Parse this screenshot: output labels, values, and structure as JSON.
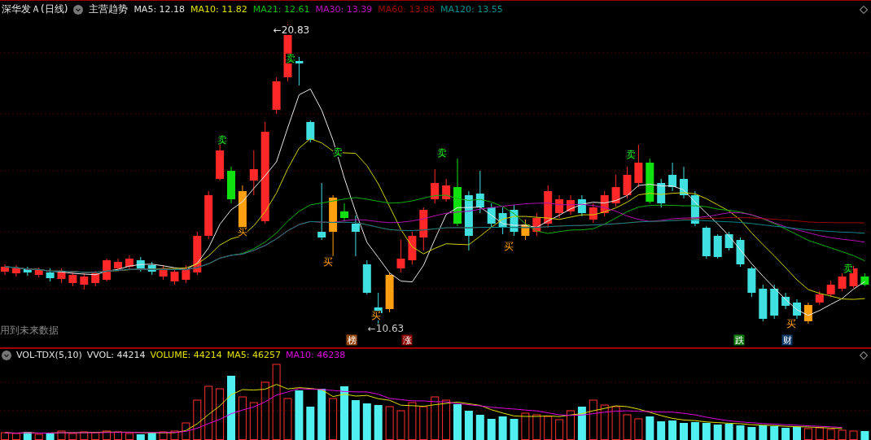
{
  "header": {
    "title": "深华发Ａ(日线)",
    "indicator_name": "主营趋势",
    "values": [
      {
        "text": "MA5: 12.18",
        "color": "#e0e0e0"
      },
      {
        "text": "MA10: 11.82",
        "color": "#e0e000"
      },
      {
        "text": "MA21: 12.61",
        "color": "#10c010"
      },
      {
        "text": "MA30: 13.39",
        "color": "#c010c0"
      },
      {
        "text": "MA60: 13.88",
        "color": "#a00000"
      },
      {
        "text": "MA120: 13.55",
        "color": "#009090"
      }
    ]
  },
  "main_chart": {
    "signals": [
      {
        "text": "卖",
        "kind": "sell"
      },
      {
        "text": "买",
        "kind": "buy"
      },
      {
        "text": "卖",
        "kind": "sell"
      },
      {
        "text": "买",
        "kind": "buy"
      },
      {
        "text": "卖",
        "kind": "sell"
      },
      {
        "text": "买",
        "kind": "buy"
      },
      {
        "text": "卖",
        "kind": "sell"
      },
      {
        "text": "买",
        "kind": "buy"
      },
      {
        "text": "卖",
        "kind": "sell"
      },
      {
        "text": "买",
        "kind": "buy"
      },
      {
        "text": "卖",
        "kind": "sell"
      }
    ],
    "price_marks": [
      {
        "text": "←20.83",
        "kind": "high"
      },
      {
        "text": "←10.63",
        "kind": "low"
      }
    ],
    "badges": [
      {
        "text": "榜",
        "color": "#9a4a10"
      },
      {
        "text": "涨",
        "color": "#8a0000"
      },
      {
        "text": "跌",
        "color": "#107a10"
      },
      {
        "text": "财",
        "color": "#103a6a"
      }
    ],
    "note": "用到未来数据"
  },
  "volume_header": {
    "name": "VOL-TDX(5,10)",
    "values": [
      {
        "text": "VVOL: 44214",
        "color": "#e0e0e0"
      },
      {
        "text": "VOLUME: 44214",
        "color": "#e0e000"
      },
      {
        "text": "MA5: 46257",
        "color": "#e0e000"
      },
      {
        "text": "MA10: 46238",
        "color": "#e000e0"
      }
    ]
  }
}
